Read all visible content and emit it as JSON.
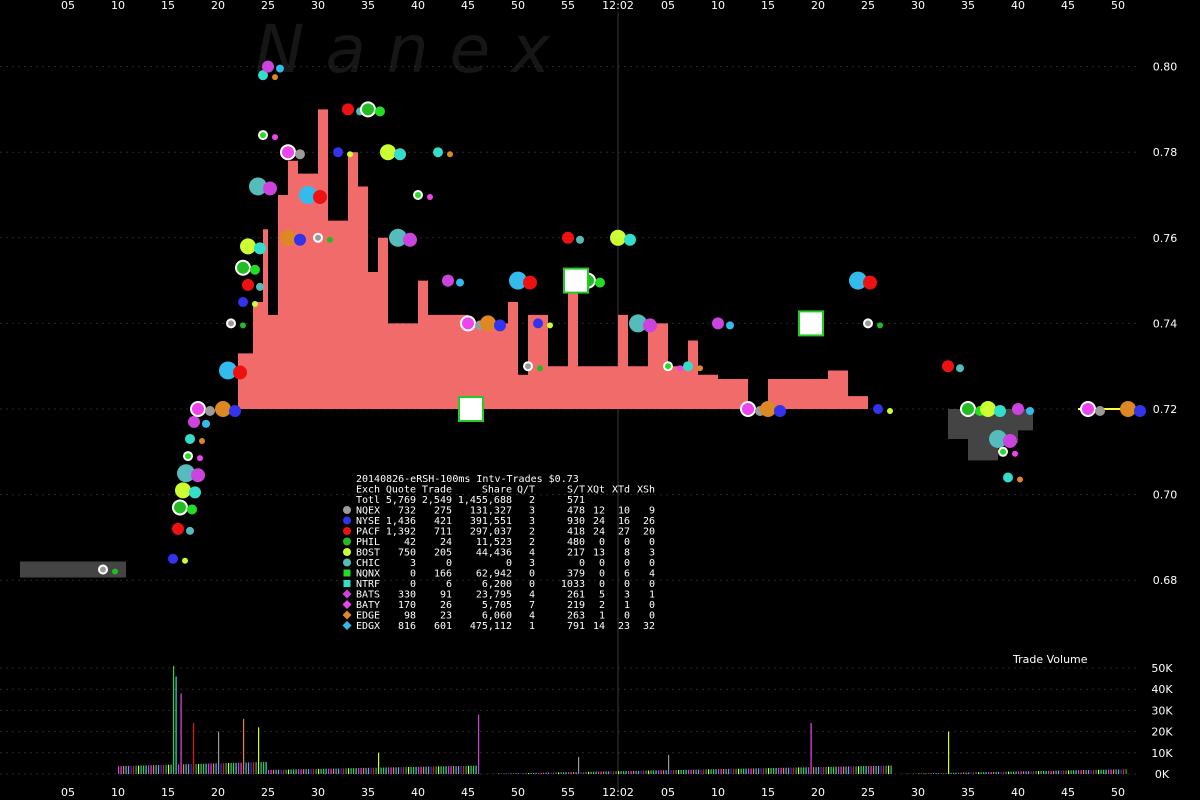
{
  "chart_data": {
    "type": "scatter",
    "watermark": "N a n e x",
    "time_axis": {
      "ticks": [
        "05",
        "10",
        "15",
        "20",
        "25",
        "30",
        "35",
        "40",
        "45",
        "50",
        "55",
        "12:02",
        "05",
        "10",
        "15",
        "20",
        "25",
        "30",
        "35",
        "40",
        "45",
        "50"
      ]
    },
    "price_axis": {
      "ylim": [
        0.665,
        0.81
      ],
      "ticks": [
        "0.80",
        "0.78",
        "0.76",
        "0.74",
        "0.72",
        "0.70",
        "0.68"
      ]
    },
    "volume_axis": {
      "title": "Trade Volume",
      "ylim": [
        0,
        50000
      ],
      "ticks": [
        "50K",
        "40K",
        "30K",
        "20K",
        "10K",
        "0K"
      ]
    },
    "table": {
      "title": "20140826-eRSH-100ms Intv-Trades $0.73",
      "headers": [
        "Exch",
        "Quote",
        "Trade",
        "Share",
        "Q/T",
        "S/T",
        "XQt",
        "XTd",
        "XSh"
      ],
      "total": {
        "label": "Totl",
        "quote": "5,769",
        "trade": "2,549",
        "share": "1,455,688",
        "qt": "2",
        "st": "571",
        "xqt": "",
        "xtd": "",
        "xsh": ""
      },
      "rows": [
        {
          "exch": "NQEX",
          "quote": "732",
          "trade": "275",
          "share": "131,327",
          "qt": "3",
          "st": "478",
          "xqt": "12",
          "xtd": "10",
          "xsh": "9",
          "color": "#9a9a9a",
          "shape": "circle"
        },
        {
          "exch": "NYSE",
          "quote": "1,436",
          "trade": "421",
          "share": "391,551",
          "qt": "3",
          "st": "930",
          "xqt": "24",
          "xtd": "16",
          "xsh": "26",
          "color": "#3333ee",
          "shape": "circle"
        },
        {
          "exch": "PACF",
          "quote": "1,392",
          "trade": "711",
          "share": "297,037",
          "qt": "2",
          "st": "418",
          "xqt": "24",
          "xtd": "27",
          "xsh": "20",
          "color": "#ee1111",
          "shape": "octagon"
        },
        {
          "exch": "PHIL",
          "quote": "42",
          "trade": "24",
          "share": "11,523",
          "qt": "2",
          "st": "480",
          "xqt": "0",
          "xtd": "0",
          "xsh": "0",
          "color": "#22bb22",
          "shape": "circle"
        },
        {
          "exch": "BOST",
          "quote": "750",
          "trade": "205",
          "share": "44,436",
          "qt": "4",
          "st": "217",
          "xqt": "13",
          "xtd": "8",
          "xsh": "3",
          "color": "#ccff33",
          "shape": "octagon"
        },
        {
          "exch": "CHIC",
          "quote": "3",
          "trade": "0",
          "share": "0",
          "qt": "3",
          "st": "0",
          "xqt": "0",
          "xtd": "0",
          "xsh": "0",
          "color": "#55bbbb",
          "shape": "circle"
        },
        {
          "exch": "NQNX",
          "quote": "0",
          "trade": "166",
          "share": "62,942",
          "qt": "0",
          "st": "379",
          "xqt": "0",
          "xtd": "6",
          "xsh": "4",
          "color": "#22dd22",
          "shape": "square"
        },
        {
          "exch": "NTRF",
          "quote": "0",
          "trade": "6",
          "share": "6,200",
          "qt": "0",
          "st": "1033",
          "xqt": "0",
          "xtd": "0",
          "xsh": "0",
          "color": "#33ddcc",
          "shape": "square"
        },
        {
          "exch": "BATS",
          "quote": "330",
          "trade": "91",
          "share": "23,795",
          "qt": "4",
          "st": "261",
          "xqt": "5",
          "xtd": "3",
          "xsh": "1",
          "color": "#cc44dd",
          "shape": "diamond"
        },
        {
          "exch": "BATY",
          "quote": "170",
          "trade": "26",
          "share": "5,705",
          "qt": "7",
          "st": "219",
          "xqt": "2",
          "xtd": "1",
          "xsh": "0",
          "color": "#ee44ee",
          "shape": "diamond"
        },
        {
          "exch": "EDGE",
          "quote": "98",
          "trade": "23",
          "share": "6,060",
          "qt": "4",
          "st": "263",
          "xqt": "1",
          "xtd": "0",
          "xsh": "0",
          "color": "#dd8822",
          "shape": "diamond"
        },
        {
          "exch": "EDGX",
          "quote": "816",
          "trade": "601",
          "share": "475,112",
          "qt": "1",
          "st": "791",
          "xqt": "14",
          "xtd": "23",
          "xsh": "32",
          "color": "#33bbee",
          "shape": "diamond"
        }
      ]
    },
    "spread_band_color": "#f26b6b",
    "spread_band_color_late": "#444444",
    "nbbo_line_color": "#ffff33",
    "quote_clusters": [
      {
        "t": 3.5,
        "p": 0.6825
      },
      {
        "t": 10.5,
        "p": 0.685
      },
      {
        "t": 11,
        "p": 0.692
      },
      {
        "t": 11.2,
        "p": 0.697
      },
      {
        "t": 11.5,
        "p": 0.701
      },
      {
        "t": 11.8,
        "p": 0.705
      },
      {
        "t": 12,
        "p": 0.709
      },
      {
        "t": 12.2,
        "p": 0.713
      },
      {
        "t": 12.6,
        "p": 0.717
      },
      {
        "t": 13,
        "p": 0.72
      },
      {
        "t": 15.5,
        "p": 0.72
      },
      {
        "t": 16,
        "p": 0.729
      },
      {
        "t": 16.3,
        "p": 0.74
      },
      {
        "t": 17.5,
        "p": 0.745
      },
      {
        "t": 18,
        "p": 0.749
      },
      {
        "t": 17.5,
        "p": 0.753
      },
      {
        "t": 18,
        "p": 0.758
      },
      {
        "t": 19,
        "p": 0.772
      },
      {
        "t": 19.5,
        "p": 0.784
      },
      {
        "t": 19.5,
        "p": 0.798
      },
      {
        "t": 20,
        "p": 0.8
      },
      {
        "t": 22,
        "p": 0.78
      },
      {
        "t": 22,
        "p": 0.76
      },
      {
        "t": 24,
        "p": 0.77
      },
      {
        "t": 25,
        "p": 0.76
      },
      {
        "t": 27,
        "p": 0.78
      },
      {
        "t": 28,
        "p": 0.79
      },
      {
        "t": 30,
        "p": 0.79
      },
      {
        "t": 32,
        "p": 0.78
      },
      {
        "t": 33,
        "p": 0.76
      },
      {
        "t": 35,
        "p": 0.77
      },
      {
        "t": 37,
        "p": 0.78
      },
      {
        "t": 38,
        "p": 0.75
      },
      {
        "t": 40,
        "p": 0.74
      },
      {
        "t": 42,
        "p": 0.74
      },
      {
        "t": 45,
        "p": 0.75
      },
      {
        "t": 46,
        "p": 0.73
      },
      {
        "t": 47,
        "p": 0.74
      },
      {
        "t": 50,
        "p": 0.76
      },
      {
        "t": 52,
        "p": 0.75
      },
      {
        "t": 55,
        "p": 0.76
      },
      {
        "t": 57,
        "p": 0.74
      },
      {
        "t": 60,
        "p": 0.73
      },
      {
        "t": 62,
        "p": 0.73
      },
      {
        "t": 65,
        "p": 0.74
      },
      {
        "t": 68,
        "p": 0.72
      },
      {
        "t": 70,
        "p": 0.72
      },
      {
        "t": 79,
        "p": 0.75
      },
      {
        "t": 80,
        "p": 0.74
      },
      {
        "t": 81,
        "p": 0.72
      },
      {
        "t": 88,
        "p": 0.73
      },
      {
        "t": 90,
        "p": 0.72
      },
      {
        "t": 92,
        "p": 0.72
      },
      {
        "t": 93,
        "p": 0.713
      },
      {
        "t": 93.5,
        "p": 0.71
      },
      {
        "t": 94,
        "p": 0.704
      },
      {
        "t": 95,
        "p": 0.72
      },
      {
        "t": 102,
        "p": 0.72
      },
      {
        "t": 106,
        "p": 0.72
      }
    ]
  }
}
